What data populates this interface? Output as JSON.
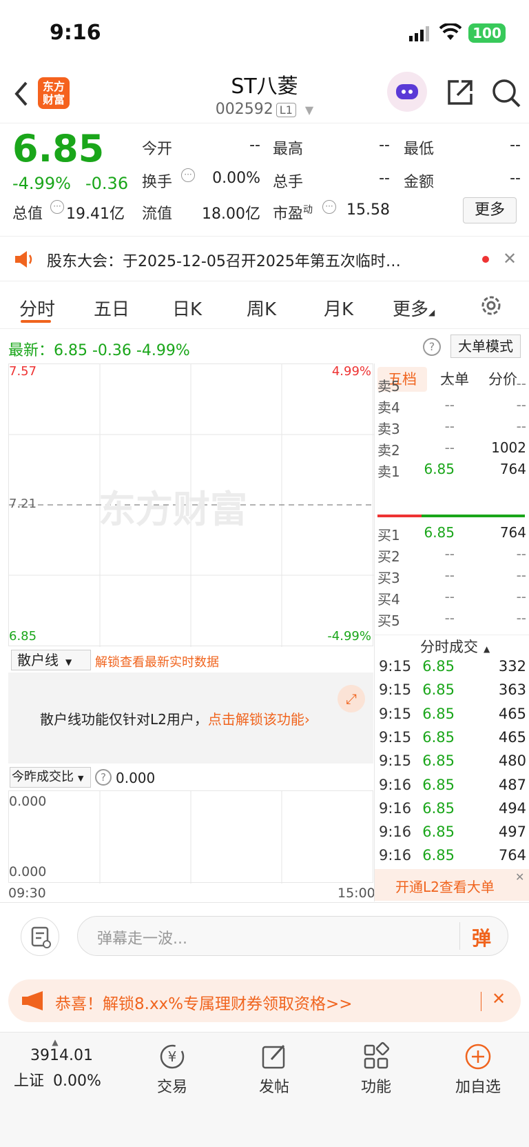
{
  "status_bar": {
    "time": "9:16",
    "battery": "100"
  },
  "header": {
    "title": "ST八菱",
    "code": "002592",
    "level_badge": "L1",
    "logo_line1": "东方",
    "logo_line2": "财富"
  },
  "quote": {
    "price": "6.85",
    "pct_change": "-4.99%",
    "change": "-0.36",
    "fields": [
      {
        "label": "今开",
        "value": "--"
      },
      {
        "label": "最高",
        "value": "--"
      },
      {
        "label": "最低",
        "value": "--"
      },
      {
        "label": "换手",
        "value": "0.00%"
      },
      {
        "label": "总手",
        "value": "--"
      },
      {
        "label": "金额",
        "value": "--"
      },
      {
        "label": "总值",
        "value": "19.41亿"
      },
      {
        "label": "流值",
        "value": "18.00亿"
      },
      {
        "label": "市盈",
        "value": "15.58"
      }
    ],
    "pe_superscript": "动",
    "more_label": "更多"
  },
  "notice": {
    "text": "股东大会：于2025-12-05召开2025年第五次临时…"
  },
  "tabs": [
    "分时",
    "五日",
    "日K",
    "周K",
    "月K",
    "更多"
  ],
  "latest": {
    "text": "最新：6.85  -0.36  -4.99%",
    "big_order_label": "大单模式"
  },
  "chart": {
    "price_high": "7.57",
    "price_mid": "7.21",
    "price_low": "6.85",
    "pct_high": "4.99%",
    "pct_low": "-4.99%",
    "watermark": "东方财富",
    "time_start": "09:30",
    "time_end": "15:00"
  },
  "chart_data": {
    "type": "line",
    "x": [
      "09:30",
      "15:00"
    ],
    "ylim": [
      6.85,
      7.57
    ],
    "series": []
  },
  "order_book": {
    "tabs": [
      "五档",
      "大单",
      "分价"
    ],
    "asks": [
      {
        "label": "卖5",
        "price": "--",
        "vol": "--"
      },
      {
        "label": "卖4",
        "price": "--",
        "vol": "--"
      },
      {
        "label": "卖3",
        "price": "--",
        "vol": "--"
      },
      {
        "label": "卖2",
        "price": "--",
        "vol": "1002"
      },
      {
        "label": "卖1",
        "price": "6.85",
        "vol": "764"
      }
    ],
    "bids": [
      {
        "label": "买1",
        "price": "6.85",
        "vol": "764"
      },
      {
        "label": "买2",
        "price": "--",
        "vol": "--"
      },
      {
        "label": "买3",
        "price": "--",
        "vol": "--"
      },
      {
        "label": "买4",
        "price": "--",
        "vol": "--"
      },
      {
        "label": "买5",
        "price": "--",
        "vol": "--"
      }
    ],
    "trades_title": "分时成交",
    "trades": [
      {
        "t": "9:15",
        "p": "6.85",
        "v": "332"
      },
      {
        "t": "9:15",
        "p": "6.85",
        "v": "363"
      },
      {
        "t": "9:15",
        "p": "6.85",
        "v": "465"
      },
      {
        "t": "9:15",
        "p": "6.85",
        "v": "465"
      },
      {
        "t": "9:15",
        "p": "6.85",
        "v": "480"
      },
      {
        "t": "9:16",
        "p": "6.85",
        "v": "487"
      },
      {
        "t": "9:16",
        "p": "6.85",
        "v": "494"
      },
      {
        "t": "9:16",
        "p": "6.85",
        "v": "497"
      },
      {
        "t": "9:16",
        "p": "6.85",
        "v": "764"
      }
    ],
    "l2_label": "开通L2查看大单"
  },
  "retail": {
    "select_label": "散户线",
    "unlock_hint": "解锁查看最新实时数据",
    "message": "散户线功能仅针对L2用户，",
    "unlock_link": "点击解锁该功能"
  },
  "ratio": {
    "select_label": "今昨成交比",
    "value": "0.000",
    "top": "0.000",
    "bottom": "0.000"
  },
  "comment": {
    "placeholder": "弹幕走一波...",
    "danmu_btn": "弹"
  },
  "promo": {
    "text": "恭喜！解锁8.xx%专属理财券领取资格>>"
  },
  "bottom_nav": {
    "index_value": "3914.01",
    "index_name": "上证",
    "index_change": "0.00%",
    "items": [
      "交易",
      "发帖",
      "功能",
      "加自选"
    ]
  }
}
